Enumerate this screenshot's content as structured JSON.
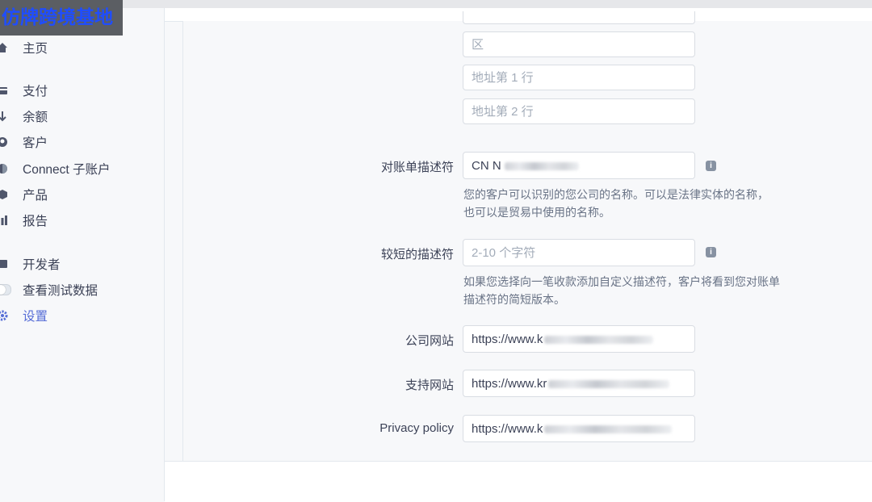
{
  "watermark": "仿牌跨境基地",
  "sidebar": {
    "items": [
      {
        "label": "主页",
        "icon": "home-icon"
      },
      {
        "label": "支付",
        "icon": "payments-icon"
      },
      {
        "label": "余额",
        "icon": "balance-icon"
      },
      {
        "label": "客户",
        "icon": "customers-icon"
      },
      {
        "label": "Connect 子账户",
        "icon": "connect-icon"
      },
      {
        "label": "产品",
        "icon": "products-icon"
      },
      {
        "label": "报告",
        "icon": "reports-icon"
      },
      {
        "label": "开发者",
        "icon": "developers-icon"
      },
      {
        "label": "查看测试数据",
        "icon": "toggle-icon"
      },
      {
        "label": "设置",
        "icon": "gear-icon"
      }
    ],
    "active_color": "#556cd6"
  },
  "form": {
    "district_placeholder": "区",
    "address1_placeholder": "地址第 1 行",
    "address2_placeholder": "地址第 2 行",
    "statement": {
      "label": "对账单描述符",
      "value": "CN N",
      "help": "您的客户可以识别的您公司的名称。可以是法律实体的名称，也可以是贸易中使用的名称。"
    },
    "short_statement": {
      "label": "较短的描述符",
      "placeholder": "2-10 个字符",
      "help": "如果您选择向一笔收款添加自定义描述符，客户将看到您对账单描述符的简短版本。"
    },
    "company_site": {
      "label": "公司网站",
      "value": "https://www.k"
    },
    "support_site": {
      "label": "支持网站",
      "value": "https://www.kr"
    },
    "privacy": {
      "label": "Privacy policy",
      "value": "https://www.k"
    }
  }
}
